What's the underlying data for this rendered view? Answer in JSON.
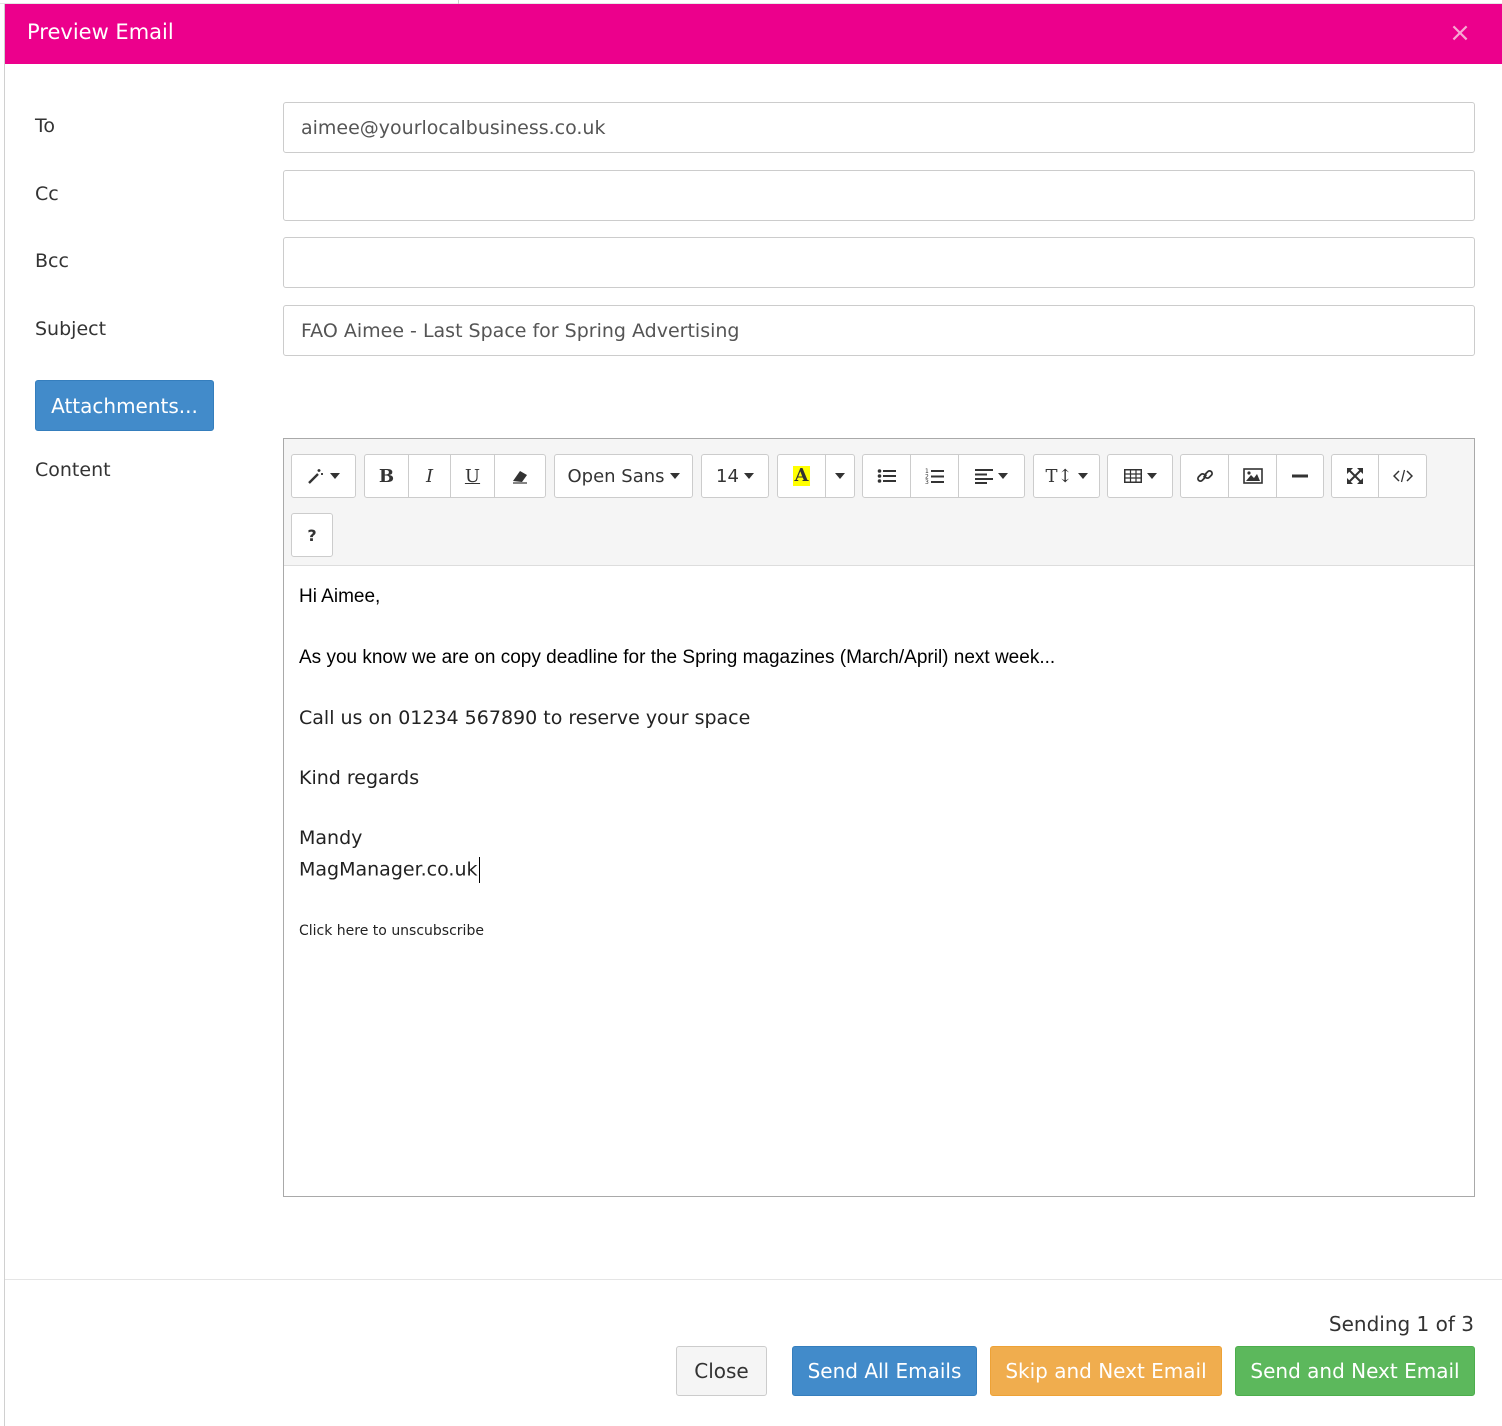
{
  "modal": {
    "title": "Preview Email",
    "close_glyph": "×"
  },
  "form": {
    "to_label": "To",
    "to_value": "aimee@yourlocalbusiness.co.uk",
    "cc_label": "Cc",
    "cc_value": "",
    "bcc_label": "Bcc",
    "bcc_value": "",
    "subject_label": "Subject",
    "subject_value": "FAO Aimee - Last Space for Spring Advertising",
    "attachments_label": "Attachments...",
    "content_label": "Content"
  },
  "toolbar": {
    "font_family": "Open Sans",
    "font_size": "14",
    "bold": "B",
    "italic": "I",
    "underline": "U",
    "highlight": "A",
    "height": "T↕",
    "help": "?"
  },
  "content": {
    "greeting": "Hi Aimee,",
    "line1": "As you know we are on copy deadline for the Spring magazines (March/April) next week...",
    "line2": "Call us on 01234 567890 to reserve your space",
    "line3": "Kind regards",
    "sign_name": "Mandy",
    "sign_site": "MagManager.co.uk",
    "unsubscribe": "Click here to unscubscribe"
  },
  "footer": {
    "status": "Sending 1 of 3",
    "close_label": "Close",
    "send_all_label": "Send All Emails",
    "skip_next_label": "Skip and Next Email",
    "send_next_label": "Send and Next Email"
  },
  "colors": {
    "header": "#ec008c",
    "primary": "#428bca",
    "warning": "#f0ad4e",
    "success": "#5cb85c"
  }
}
